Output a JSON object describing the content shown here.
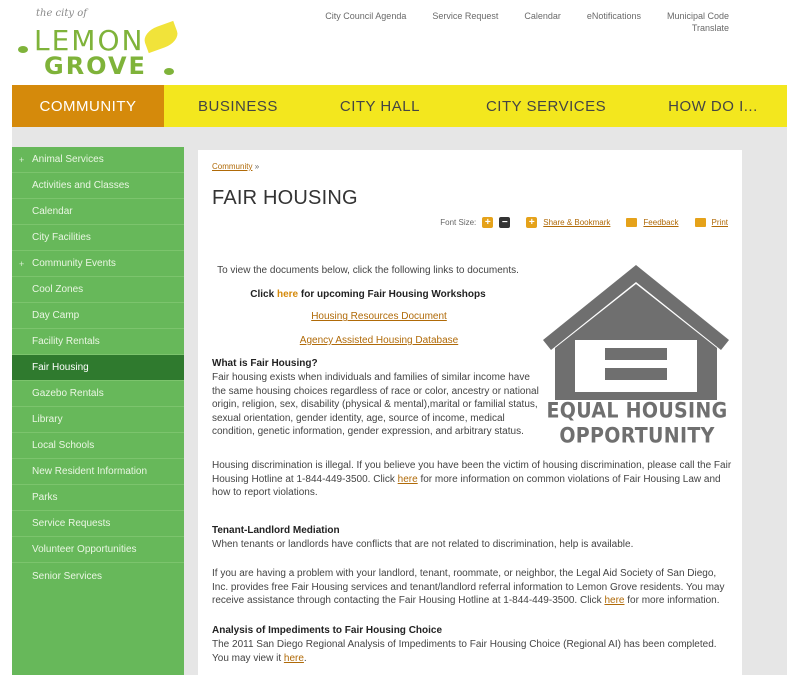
{
  "header": {
    "logo": {
      "small": "the city of",
      "line1": "LEMON",
      "line2": "GROVE"
    },
    "toplinks": [
      "City Council Agenda",
      "Service Request",
      "Calendar",
      "eNotifications",
      "Municipal Code"
    ],
    "translate": "Translate"
  },
  "nav": {
    "items": [
      "COMMUNITY",
      "BUSINESS",
      "CITY HALL",
      "CITY SERVICES",
      "HOW DO I..."
    ]
  },
  "sidebar": {
    "items": [
      {
        "label": "Animal Services",
        "plus": "+"
      },
      {
        "label": "Activities and Classes"
      },
      {
        "label": "Calendar"
      },
      {
        "label": "City Facilities"
      },
      {
        "label": "Community Events",
        "plus": "+"
      },
      {
        "label": "Cool Zones"
      },
      {
        "label": "Day Camp"
      },
      {
        "label": "Facility Rentals"
      },
      {
        "label": "Fair Housing"
      },
      {
        "label": "Gazebo Rentals"
      },
      {
        "label": "Library"
      },
      {
        "label": "Local Schools"
      },
      {
        "label": "New Resident Information"
      },
      {
        "label": "Parks"
      },
      {
        "label": "Service Requests"
      },
      {
        "label": "Volunteer Opportunities"
      },
      {
        "label": "Senior Services"
      }
    ]
  },
  "content": {
    "breadcrumb": "Community",
    "breadcrumb_sep": "»",
    "title": "FAIR HOUSING",
    "tools": {
      "font_size": "Font Size:",
      "plus": "+",
      "minus": "−",
      "share": "Share & Bookmark",
      "feedback": "Feedback",
      "print": "Print"
    },
    "intro": "To view the documents below, click the following links to documents.",
    "workshops_pre": "Click",
    "workshops_here": "here",
    "workshops_post": "for upcoming Fair Housing Workshops",
    "doc1": "Housing Resources Document",
    "doc2": "Agency Assisted Housing Database",
    "what_heading": "What is Fair Housing?",
    "what_body": "Fair housing exists when individuals and families of similar income have the same housing choices regardless of race or color, ancestry or national origin, religion, sex, disability (physical & mental),marital or familial status, sexual orientation, gender identity, age, source of income, medical condition, genetic information, gender expression, and arbitrary status.",
    "eho_line1": "EQUAL HOUSING",
    "eho_line2": "OPPORTUNITY",
    "discrim_pre": "Housing discrimination is illegal. If you believe you have been the victim of housing discrimination, please call the Fair Housing Hotline at 1-844-449-3500. Click",
    "discrim_here": "here",
    "discrim_post": "for more information on common violations of Fair Housing Law and how to report violations.",
    "tenant_heading": "Tenant-Landlord Mediation",
    "tenant_body": "When tenants or landlords have conflicts that are not related to discrimination, help is available.",
    "problem_pre": "If you are having a problem with your landlord, tenant, roommate, or neighbor, the Legal Aid Society of San Diego, Inc. provides free Fair Housing services and tenant/landlord referral information to Lemon Grove residents.  You may receive assistance through contacting the Fair Housing Hotline at 1-844-449-3500. Click",
    "problem_here": "here",
    "problem_post": "for more information.",
    "analysis_heading": "Analysis of Impediments to Fair Housing Choice",
    "analysis_pre": "The 2011 San Diego Regional Analysis of Impediments to Fair Housing Choice (Regional AI) has been completed. You may view it",
    "analysis_here": "here",
    "analysis_post": "."
  }
}
